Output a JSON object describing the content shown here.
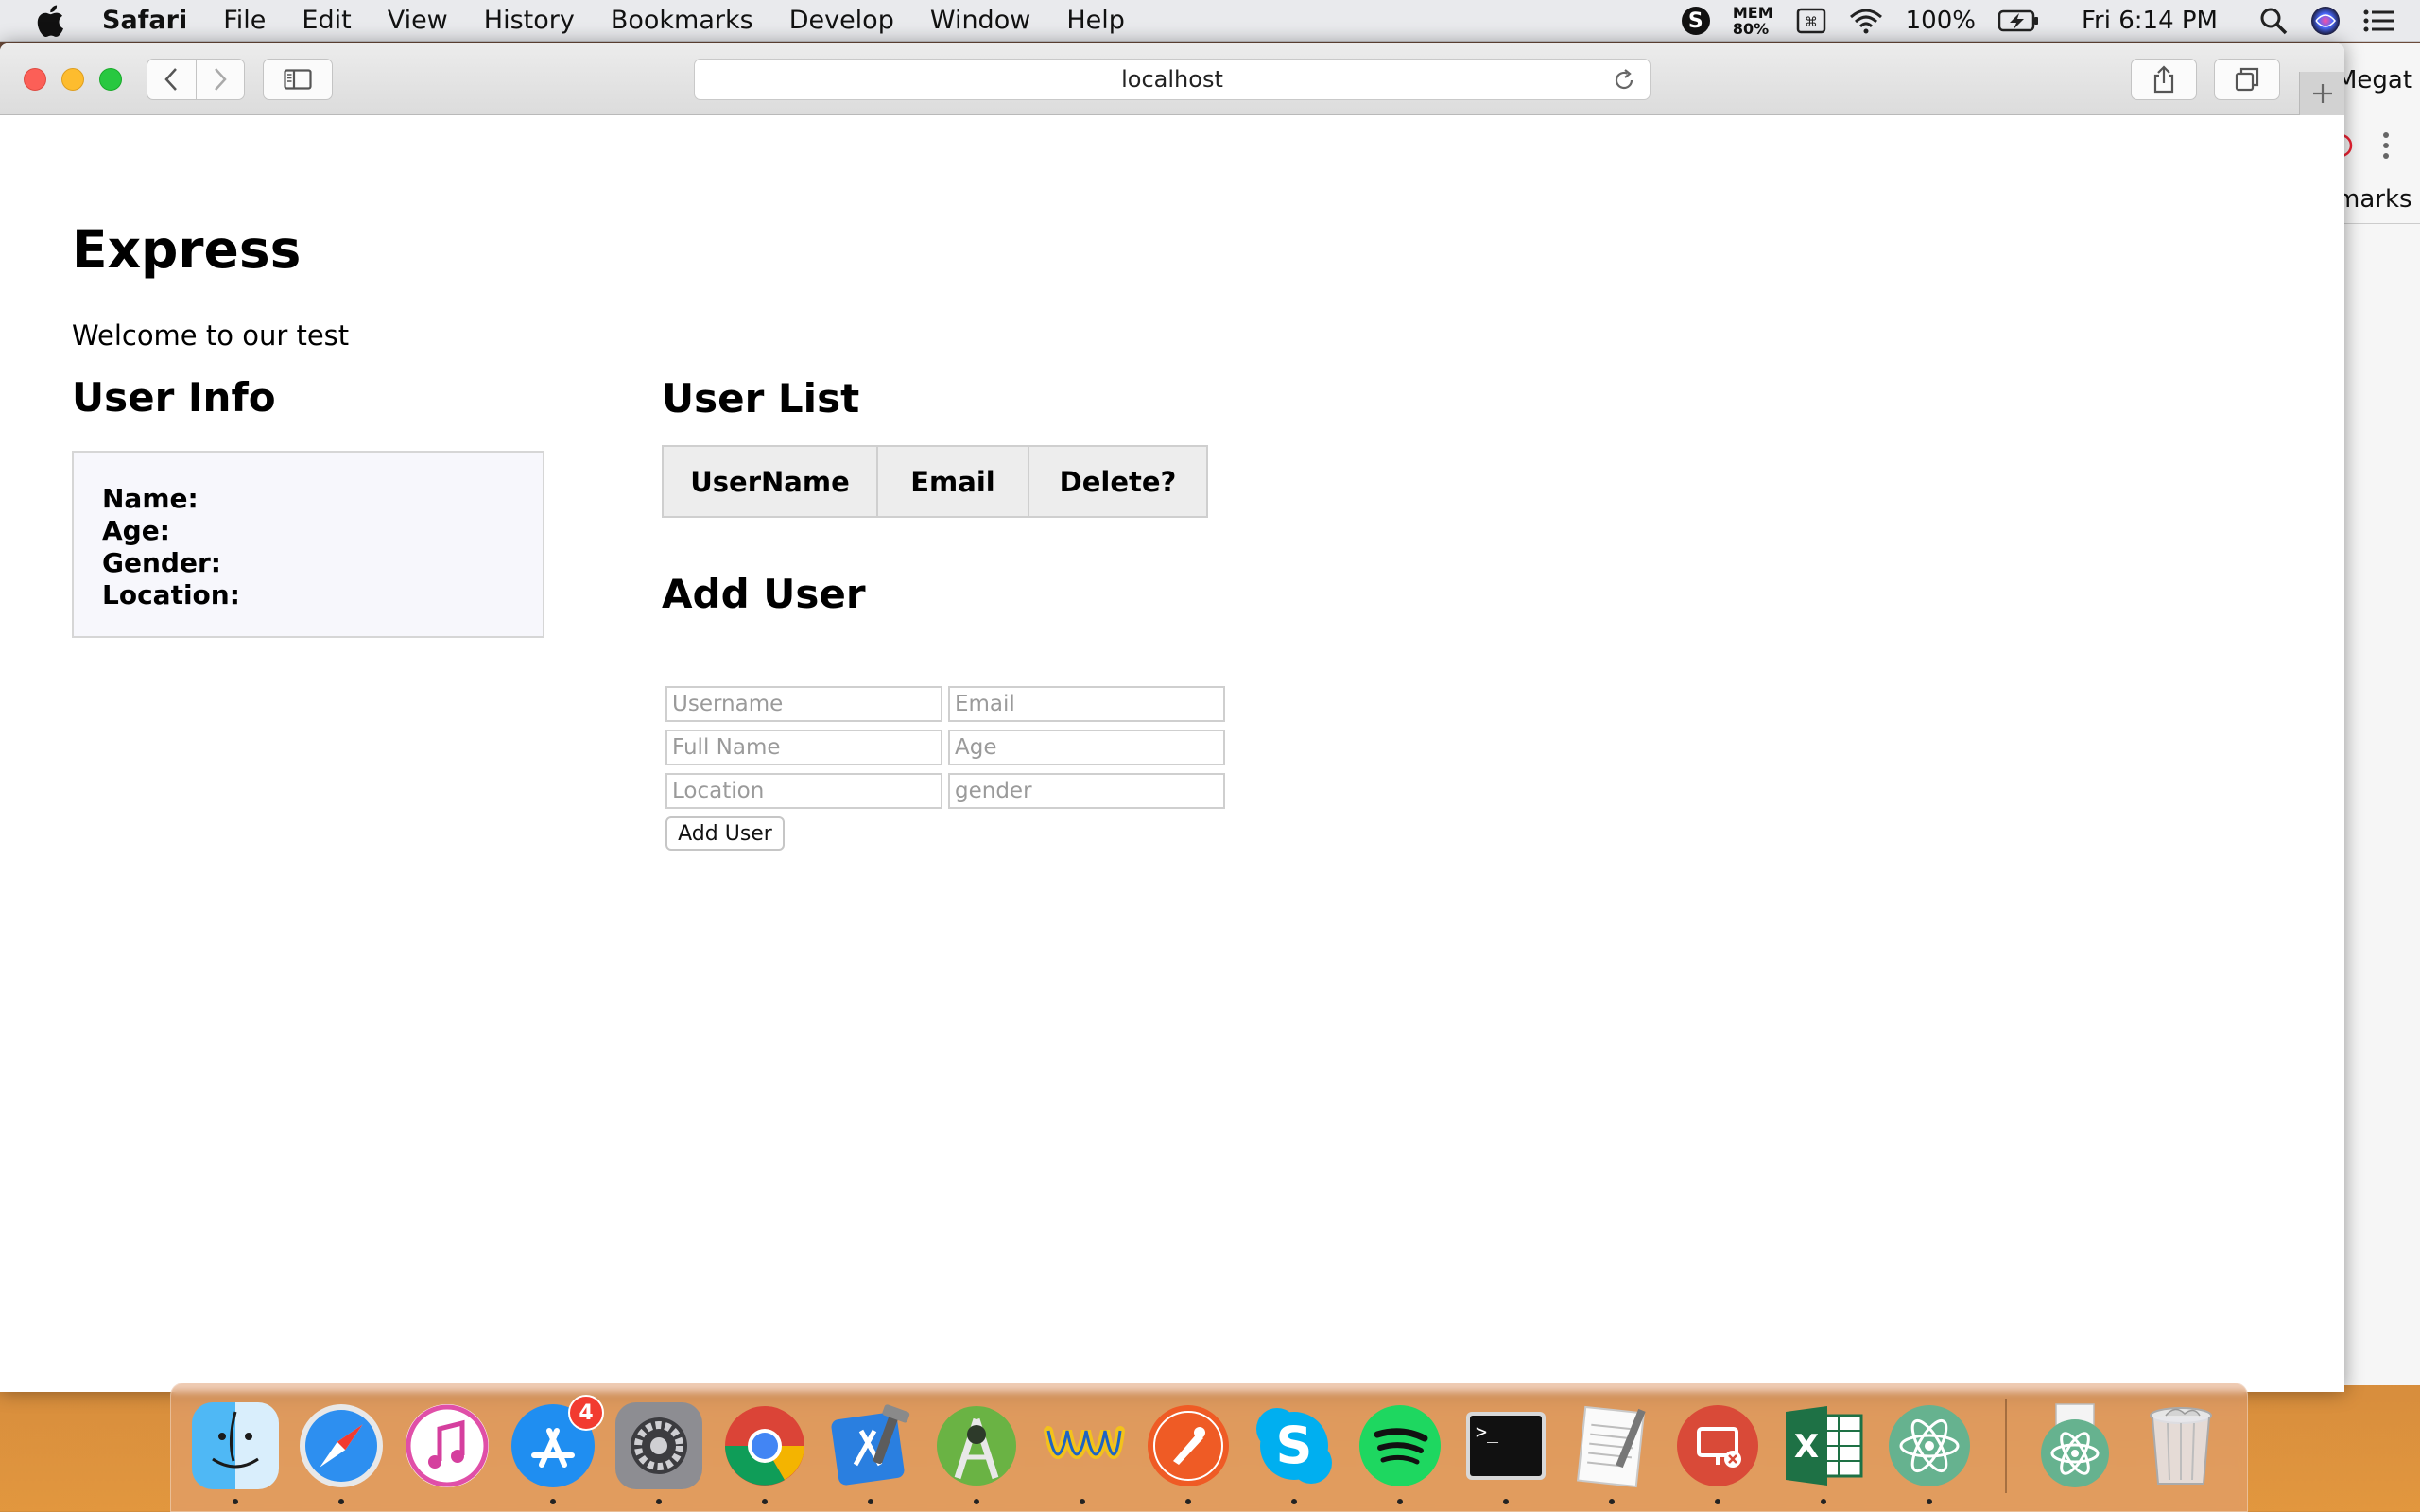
{
  "menubar": {
    "app_name": "Safari",
    "menus": [
      "File",
      "Edit",
      "View",
      "History",
      "Bookmarks",
      "Develop",
      "Window",
      "Help"
    ],
    "status": {
      "mem_label": "MEM",
      "mem_value": "80%",
      "battery": "100%",
      "clock": "Fri 6:14 PM"
    }
  },
  "browser": {
    "address": "localhost"
  },
  "background_window": {
    "tab_text": "Megat",
    "bookmarks_text": "marks"
  },
  "page": {
    "title": "Express",
    "welcome": "Welcome to our test",
    "user_info": {
      "heading": "User Info",
      "labels": [
        "Name:",
        "Age:",
        "Gender:",
        "Location:"
      ]
    },
    "user_list": {
      "heading": "User List",
      "columns": [
        "UserName",
        "Email",
        "Delete?"
      ]
    },
    "add_user": {
      "heading": "Add User",
      "placeholders": {
        "username": "Username",
        "email": "Email",
        "fullname": "Full Name",
        "age": "Age",
        "location": "Location",
        "gender": "gender"
      },
      "button": "Add User"
    }
  },
  "dock": {
    "apps": [
      "Finder",
      "Safari",
      "iTunes",
      "App Store",
      "System Preferences",
      "Google Chrome",
      "Xcode Instruments",
      "Android Studio",
      "Fetch",
      "Postman",
      "Skype",
      "Spotify",
      "Terminal",
      "TextEdit",
      "Remote Desktop",
      "Microsoft Excel",
      "Atom",
      "Atom (document)",
      "Trash"
    ],
    "app_store_badge": "4"
  },
  "colors": {
    "close": "#fc5f57",
    "minimize": "#fdbc2e",
    "maximize": "#28c840",
    "badge": "#f23b30"
  }
}
